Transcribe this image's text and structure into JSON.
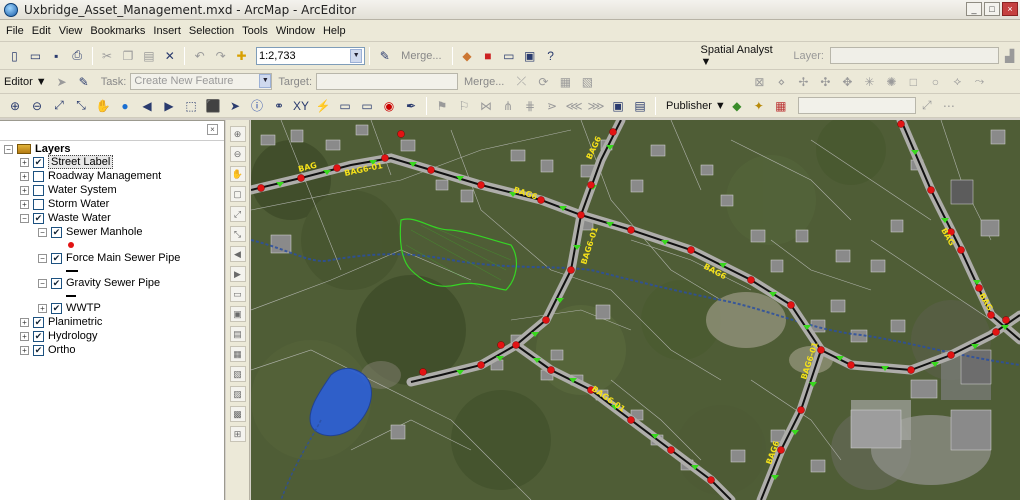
{
  "window": {
    "title": "Uxbridge_Asset_Management.mxd - ArcMap - ArcEditor",
    "controls": [
      "_",
      "□",
      "×"
    ]
  },
  "menu": [
    "File",
    "Edit",
    "View",
    "Bookmarks",
    "Insert",
    "Selection",
    "Tools",
    "Window",
    "Help"
  ],
  "standard_toolbar": {
    "scale": "1:2,733",
    "merge_label": "Merge...",
    "spatial_analyst_label": "Spatial Analyst ▼",
    "layer_label": "Layer:"
  },
  "editor_toolbar": {
    "editor_label": "Editor ▼",
    "task_label": "Task:",
    "task_value": "Create New Feature",
    "target_label": "Target:",
    "merge_label": "Merge..."
  },
  "tools_toolbar": {
    "publisher_label": "Publisher ▼"
  },
  "toc": {
    "root": "Layers",
    "items": [
      {
        "label": "Street Label",
        "checked": true,
        "expander": "+"
      },
      {
        "label": "Roadway Management",
        "checked": false,
        "expander": "+"
      },
      {
        "label": "Water System",
        "checked": false,
        "expander": "+"
      },
      {
        "label": "Storm Water",
        "checked": false,
        "expander": "+"
      },
      {
        "label": "Waste Water",
        "checked": true,
        "expander": "−"
      },
      {
        "label": "Sewer Manhole",
        "checked": true,
        "expander": "−"
      },
      {
        "label": "Force Main Sewer Pipe",
        "checked": true,
        "expander": "−"
      },
      {
        "label": "Gravity Sewer Pipe",
        "checked": true,
        "expander": "−"
      },
      {
        "label": "WWTP",
        "checked": true,
        "expander": "+"
      },
      {
        "label": "Planimetric",
        "checked": true,
        "expander": "+"
      },
      {
        "label": "Hydrology",
        "checked": true,
        "expander": "+"
      },
      {
        "label": "Ortho",
        "checked": true,
        "expander": "+"
      }
    ]
  },
  "map": {
    "street_labels": [
      "BAG",
      "BAG6-01",
      "BAG6",
      "BAG6-01",
      "BAG6",
      "BAG6",
      "BAG6-01",
      "BAG6-01",
      "BAG6",
      "BAG",
      "BAG"
    ],
    "colors": {
      "manhole": "#e21313",
      "flow_arrow": "#39d81e",
      "sewer_pipe": "#111111",
      "road": "#a8a8a8",
      "water": "#2c5fd6",
      "parcel": "#c8c8c8"
    }
  }
}
